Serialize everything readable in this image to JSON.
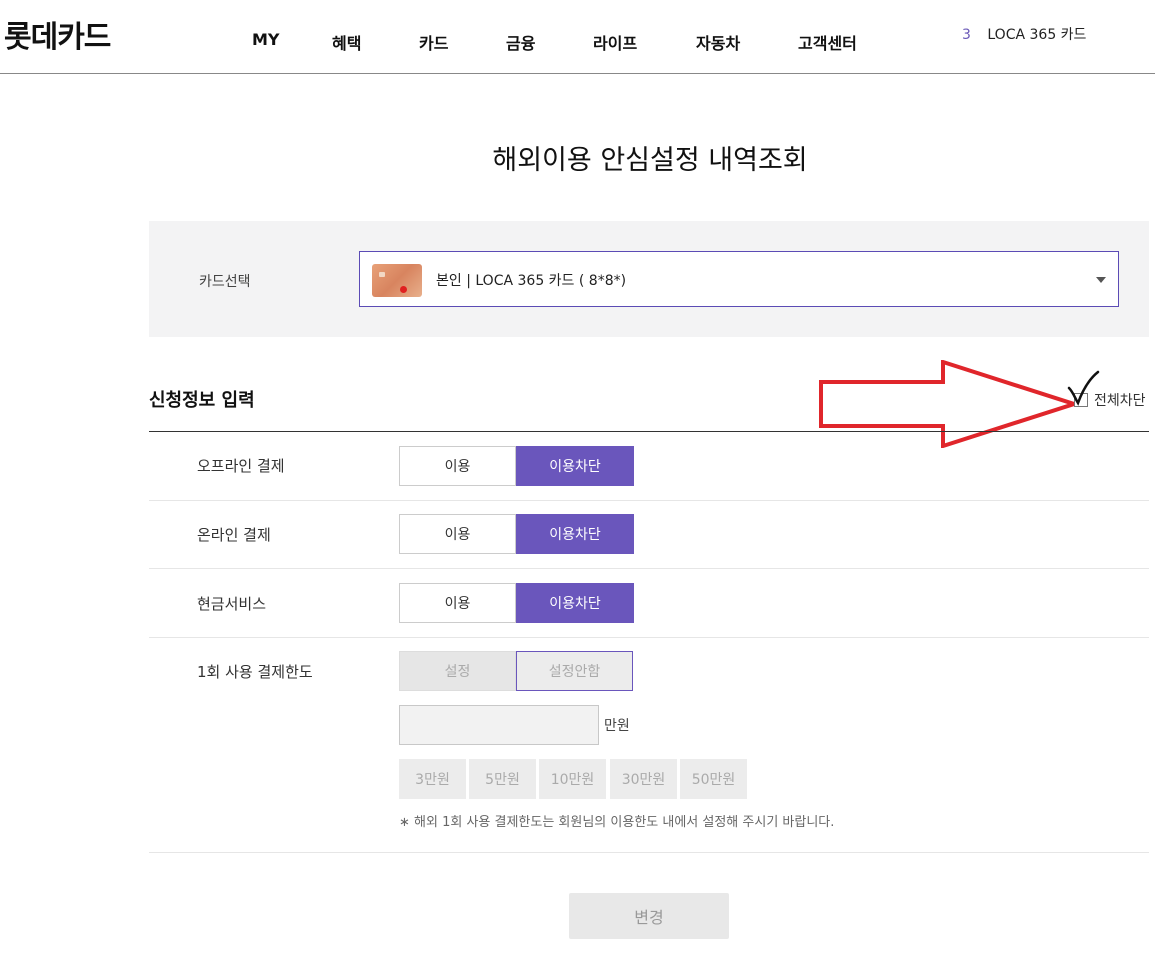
{
  "header": {
    "logo": "롯데카드",
    "nav": [
      "MY",
      "혜택",
      "카드",
      "금융",
      "라이프",
      "자동차",
      "고객센터"
    ],
    "promo_rank": "3",
    "promo_text": "LOCA 365 카드"
  },
  "page_title": "해외이용 안심설정 내역조회",
  "card_select": {
    "label": "카드선택",
    "value": "본인 | LOCA 365 카드 ( 8*8*)"
  },
  "section": {
    "title": "신청정보 입력",
    "block_all_label": "전체차단"
  },
  "rows": [
    {
      "label": "오프라인 결제",
      "option_use": "이용",
      "option_block": "이용차단",
      "selected": "이용차단"
    },
    {
      "label": "온라인 결제",
      "option_use": "이용",
      "option_block": "이용차단",
      "selected": "이용차단"
    },
    {
      "label": "현금서비스",
      "option_use": "이용",
      "option_block": "이용차단",
      "selected": "이용차단"
    }
  ],
  "limit": {
    "label": "1회 사용 결제한도",
    "option_set": "설정",
    "option_unset": "설정안함",
    "input_value": "",
    "unit": "만원",
    "quick_amounts": [
      "3만원",
      "5만원",
      "10만원",
      "30만원",
      "50만원"
    ],
    "note": "∗ 해외 1회 사용 결제한도는 회원님의 이용한도 내에서 설정해 주시기 바랍니다."
  },
  "submit_label": "변경",
  "colors": {
    "accent": "#6a56bc",
    "annotation_arrow": "#e0262b"
  }
}
